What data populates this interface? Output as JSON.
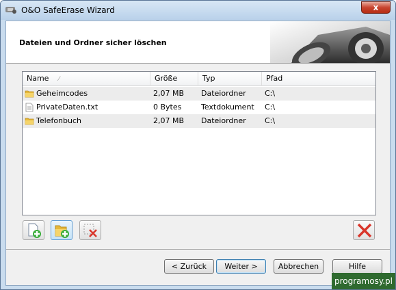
{
  "window": {
    "title": "O&O SafeErase Wizard",
    "close_label": "x"
  },
  "header": {
    "heading": "Dateien und Ordner sicher löschen"
  },
  "table": {
    "columns": [
      "Name",
      "Größe",
      "Typ",
      "Pfad"
    ],
    "rows": [
      {
        "name": "Geheimcodes",
        "size": "2,07 MB",
        "type": "Dateiordner",
        "path": "C:\\",
        "icon": "folder-icon"
      },
      {
        "name": "PrivateDaten.txt",
        "size": "0 Bytes",
        "type": "Textdokument",
        "path": "C:\\",
        "icon": "text-file-icon"
      },
      {
        "name": "Telefonbuch",
        "size": "2,07 MB",
        "type": "Dateiordner",
        "path": "C:\\",
        "icon": "folder-icon"
      }
    ]
  },
  "toolbar": {
    "add_file_icon": "add-file-icon",
    "add_folder_icon": "add-folder-icon",
    "remove_item_icon": "remove-item-icon",
    "clear_all_icon": "clear-all-icon"
  },
  "buttons": {
    "back": "< Zurück",
    "next": "Weiter >",
    "cancel": "Abbrechen",
    "help": "Hilfe"
  },
  "watermark": "programosy.pl",
  "colors": {
    "title_bar": "#c9dcee",
    "close": "#c8442f",
    "folder": "#e6b83a",
    "delete_red": "#d9362b"
  }
}
